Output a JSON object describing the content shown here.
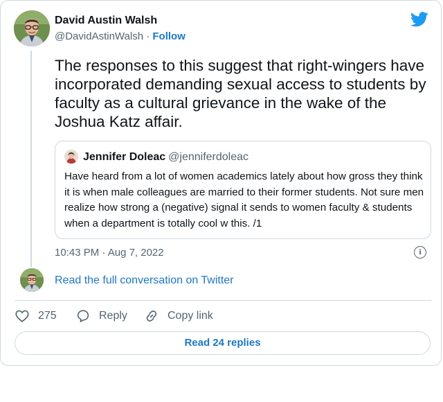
{
  "tweet": {
    "author_name": "David Austin Walsh",
    "handle": "@DavidAstinWalsh",
    "separator": "·",
    "follow_label": "Follow",
    "text": "The responses to this suggest that right-wingers have incorporated demanding sexual access to students by faculty as a cultural grievance in the wake of the Joshua Katz affair.",
    "timestamp": "10:43 PM · Aug 7, 2022",
    "info_glyph": "i"
  },
  "quote": {
    "author_name": "Jennifer Doleac",
    "handle": "@jenniferdoleac",
    "text": "Have heard from a lot of women academics lately about how gross they think it is when male colleagues are married to their former students. Not sure men realize how strong a (negative) signal it sends to women faculty & students when a department is totally cool w this. /1"
  },
  "conversation": {
    "link_label": "Read the full conversation on Twitter"
  },
  "actions": {
    "like_count": "275",
    "reply_label": "Reply",
    "copy_label": "Copy link"
  },
  "footer": {
    "read_replies_label": "Read 24 replies"
  },
  "icons": {
    "brand": "twitter-bird-icon",
    "like": "heart-icon",
    "reply": "speech-bubble-icon",
    "copy": "link-icon",
    "info": "info-icon"
  },
  "colors": {
    "accent": "#1d9bf0",
    "link": "#1d77c2",
    "muted": "#536471",
    "border": "#cfd9de"
  }
}
